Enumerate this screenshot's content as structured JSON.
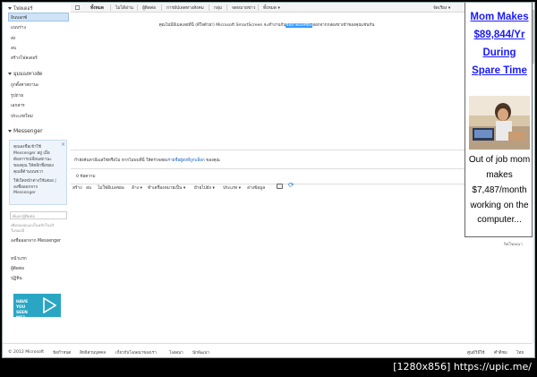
{
  "nav": {
    "folders_heading": "โฟลเดอร์",
    "folders": [
      "อินบอกซ์",
      "แบบร่าง",
      "ส่ง",
      "ลบ"
    ],
    "new_folder": "สร้างโฟลเดอร์",
    "quick_views_heading": "มุมมองทางลัด",
    "quick_views": [
      "ถูกตั้งค่าสถานะ",
      "รูปถ่าย",
      "เอกสาร"
    ],
    "new_category": "ประเภทใหม่",
    "messenger_heading": "Messenger",
    "messenger_lines": [
      "คุณลงชื่อเข้าใช้",
      "Messenger อยู่ เมื่อ",
      "ต้องการเปลี่ยนสถานะ",
      "ของคุณ ให้คลิกชื่อของ",
      "คุณที่ด้านบนขวา"
    ],
    "messenger_links": [
      "ให้เปิดหน้าต่างใช้เสมอ |",
      "ลงชื่อออกจาก",
      "Messenger"
    ],
    "search_contacts_placeholder": "ค้นหาผู้ติดต่อ",
    "messenger_hint": [
      "เพิ่มของคุณลงในคลิกในบริ",
      "ในของมี"
    ],
    "sign_out_messenger": "ลงชื่อออกจาก Messenger",
    "bottom_links": [
      "หน้าแรก",
      "ผู้ติดต่อ",
      "ปฏิทิน"
    ],
    "banner_text": "HAVE YOU SEEN ME?"
  },
  "toolbar": {
    "items": [
      "ทั้งหมด",
      "ไม่ได้อ่าน",
      "ผู้ติดต่อ",
      "การอัปเดตทางสังคม",
      "กลุ่ม",
      "จดหมายข่าว",
      "ทั้งหมด ▾"
    ],
    "sort": "จัดเรียง ▾"
  },
  "main": {
    "empty_before": "คุณไม่มีอีเมลเลยที่นี่ (ดีใจด้วย!) Microsoft SmartScreen จะทำงานกับ",
    "empty_highlight": "ข้อมาอีเมลขยะ",
    "empty_after": "ออกจากกล่องขาเข้าของคุณเช่นกัน",
    "search_prompt_before": "กำลังค้นหาอีเมลใช่หรือไม่ หากไม่พบที่นี่ ให้ตรวจสอบ",
    "search_prompt_link": "รายชื่อผู้ส่งที่ถูกบล็อก",
    "search_prompt_after": " ของคุณ",
    "count": "0 ข้อความ"
  },
  "bottom_toolbar": [
    "สร้าง",
    "ลบ",
    "ไม่ใช่อีเมลขยะ",
    "ล้าง ▾",
    "ทำเครื่องหมายเป็น ▾",
    "ย้ายไปยัง ▾",
    "ประเภท ▾",
    "ล่างข้อมูล"
  ],
  "ad": {
    "headline": [
      "Mom Makes",
      "$89,844/Yr",
      "During",
      "Spare Time"
    ],
    "body": [
      "Out of job mom",
      "makes",
      "$7,487/month",
      "working on the",
      "computer..."
    ],
    "ad_label": "ปิดโฆษณา"
  },
  "footer": {
    "copyright": "© 2012 Microsoft",
    "links": [
      "ข้อกำหนด",
      "สิทธิส่วนบุคคล",
      "เกี่ยวกับโฆษณาของเรา",
      "โฆษณา",
      "นักพัฒนา"
    ],
    "right_links": [
      "ศูนย์วิธีใช้",
      "คำติชม",
      "ไทย"
    ]
  },
  "caption": "[1280x856] https://upic.me/"
}
